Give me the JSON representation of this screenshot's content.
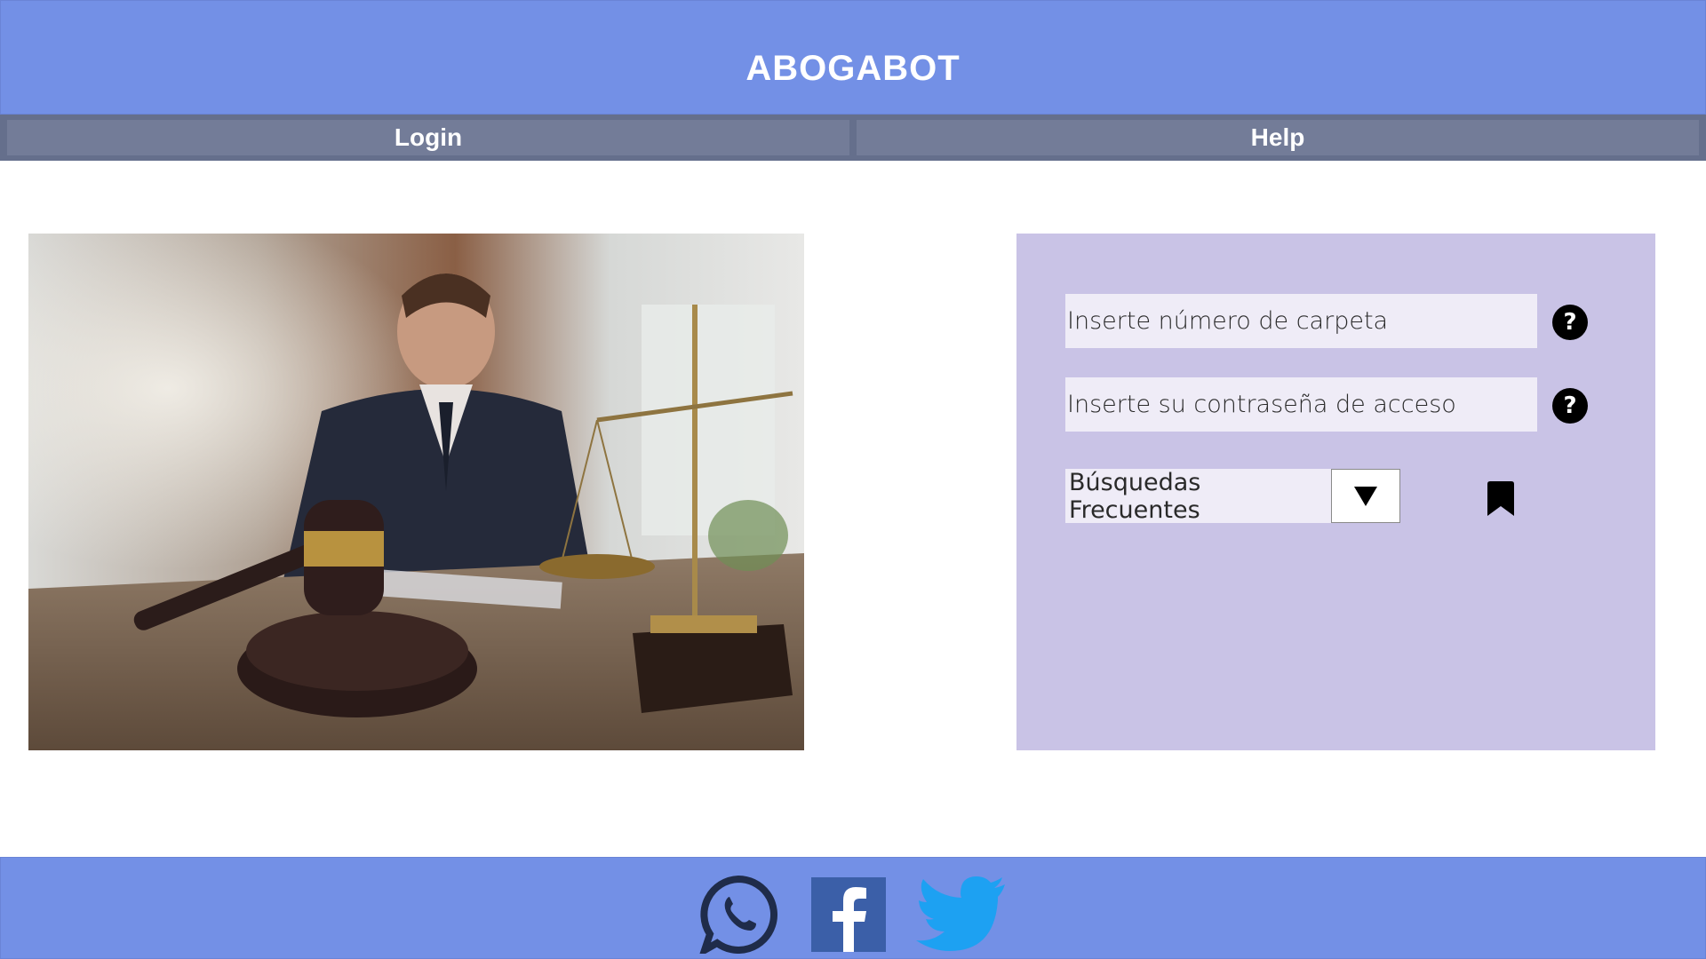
{
  "app": {
    "title": "ABOGABOT"
  },
  "nav": {
    "login_label": "Login",
    "help_label": "Help"
  },
  "form": {
    "folder_placeholder": "Inserte número de carpeta",
    "password_placeholder": "Inserte su contraseña de acceso",
    "help_glyph": "?",
    "frequent_searches_value": "Búsquedas Frecuentes",
    "dropdown_arrow": "▼"
  },
  "footer": {
    "social": [
      {
        "name": "whatsapp",
        "icon": "whatsapp-icon"
      },
      {
        "name": "facebook",
        "icon": "facebook-icon"
      },
      {
        "name": "twitter",
        "icon": "twitter-icon"
      }
    ]
  },
  "colors": {
    "header_bg": "#7390e6",
    "nav_bg": "#656f8c",
    "nav_button_bg": "#737c98",
    "panel_bg": "#c9c3e6",
    "field_bg": "#efecf7",
    "facebook": "#3b5998",
    "twitter": "#1da1f2"
  }
}
